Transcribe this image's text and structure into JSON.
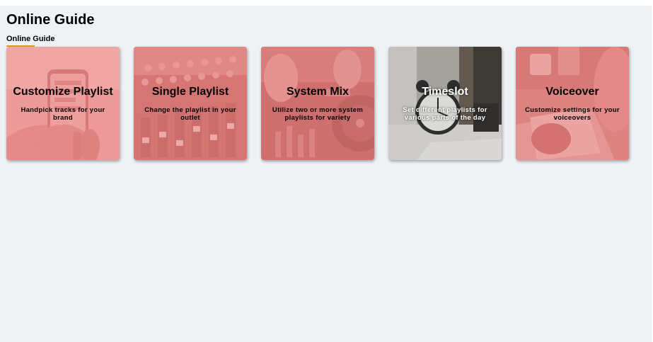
{
  "page": {
    "title": "Online Guide"
  },
  "tabs": [
    {
      "label": "Online Guide",
      "active": true
    }
  ],
  "colors": {
    "background": "#eef2f5",
    "tab_underline": "#d8a02a",
    "card_overlay": "#e88a8a"
  },
  "cards": [
    {
      "title": "Customize Playlist",
      "description": "Handpick tracks for your brand",
      "image": "phone-in-hand-photo",
      "text_color": "#000000"
    },
    {
      "title": "Single Playlist",
      "description": "Change the playlist in your outlet",
      "image": "mixing-console-photo",
      "text_color": "#000000"
    },
    {
      "title": "System Mix",
      "description": "Utilize two or more system playlists for variety",
      "image": "dj-turntable-photo",
      "text_color": "#000000"
    },
    {
      "title": "Timeslot",
      "description": "Set different playlists for various parts of the day",
      "image": "alarm-clock-photo",
      "text_color": "#ffffff"
    },
    {
      "title": "Voiceover",
      "description": "Customize settings for your voiceovers",
      "image": "notebook-writing-photo",
      "text_color": "#000000"
    }
  ]
}
